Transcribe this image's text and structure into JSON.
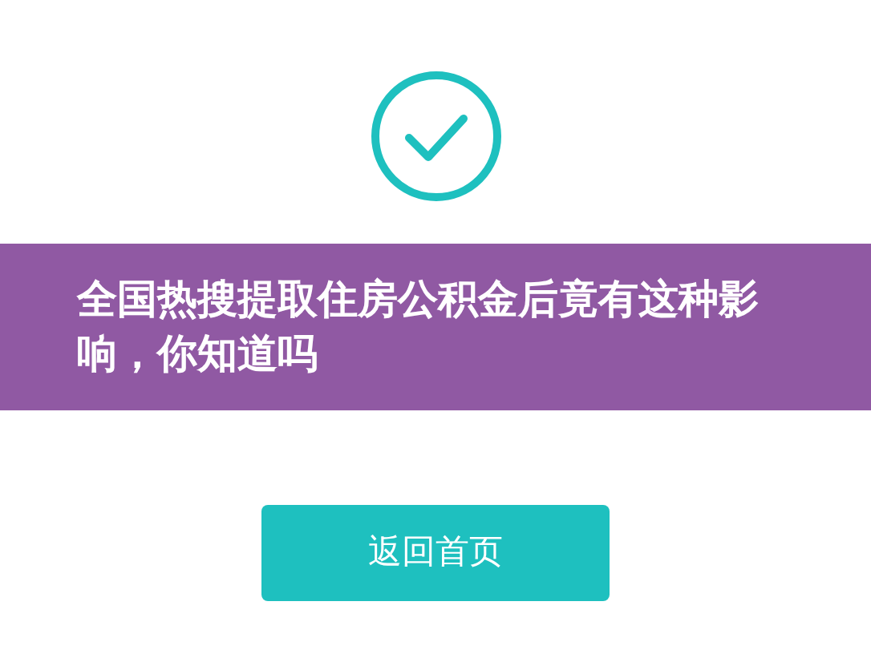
{
  "banner": {
    "title": "全国热搜提取住房公积金后竟有这种影响，你知道吗"
  },
  "buttons": [
    {
      "label": "返回首页"
    }
  ]
}
